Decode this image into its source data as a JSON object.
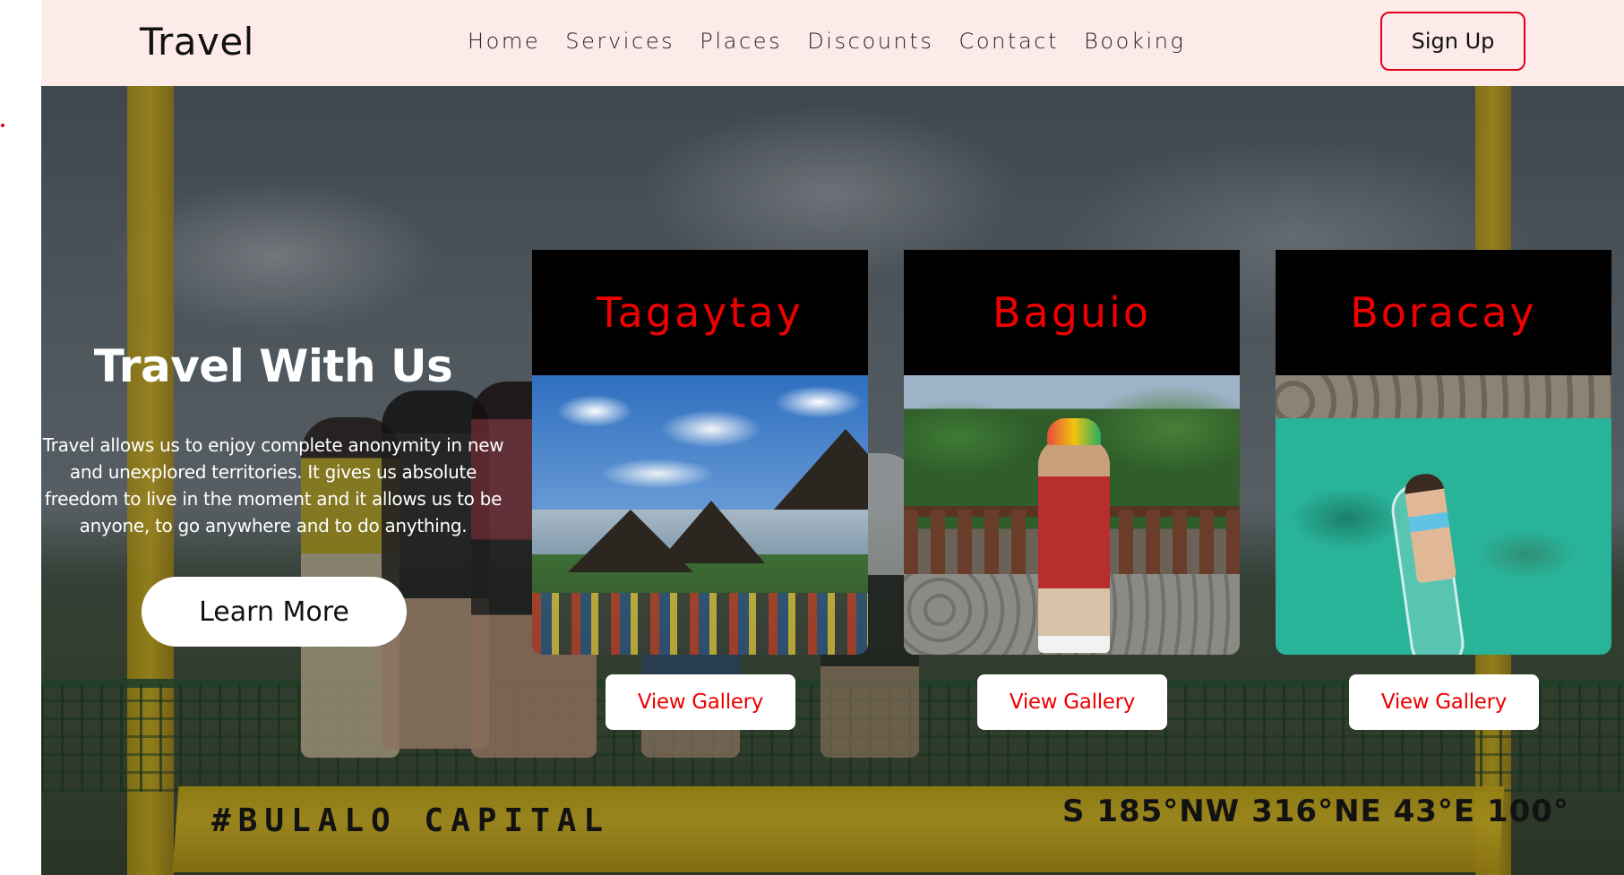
{
  "navbar": {
    "logo": "Travel",
    "links": [
      "Home",
      "Services",
      "Places",
      "Discounts",
      "Contact",
      "Booking"
    ],
    "signup_label": "Sign Up"
  },
  "hero": {
    "title": "Travel With Us",
    "description": "Travel allows us to enjoy complete anonymity in new and unexplored territories. It gives us absolute freedom to live in the moment and it allows us to be anyone, to go anywhere and to do anything.",
    "cta_label": "Learn More",
    "bench_text_left": "#BULALO CAPITAL",
    "bench_text_right": "S 185°NW 316°NE 43°E 100°"
  },
  "cards": [
    {
      "title": "Tagaytay",
      "button_label": "View Gallery"
    },
    {
      "title": "Baguio",
      "button_label": "View Gallery"
    },
    {
      "title": "Boracay",
      "button_label": "View Gallery"
    }
  ],
  "colors": {
    "navbar_bg": "#fdebea",
    "accent_red": "#ee0000",
    "signup_border": "#e0001a",
    "card_header_bg": "#000000"
  }
}
